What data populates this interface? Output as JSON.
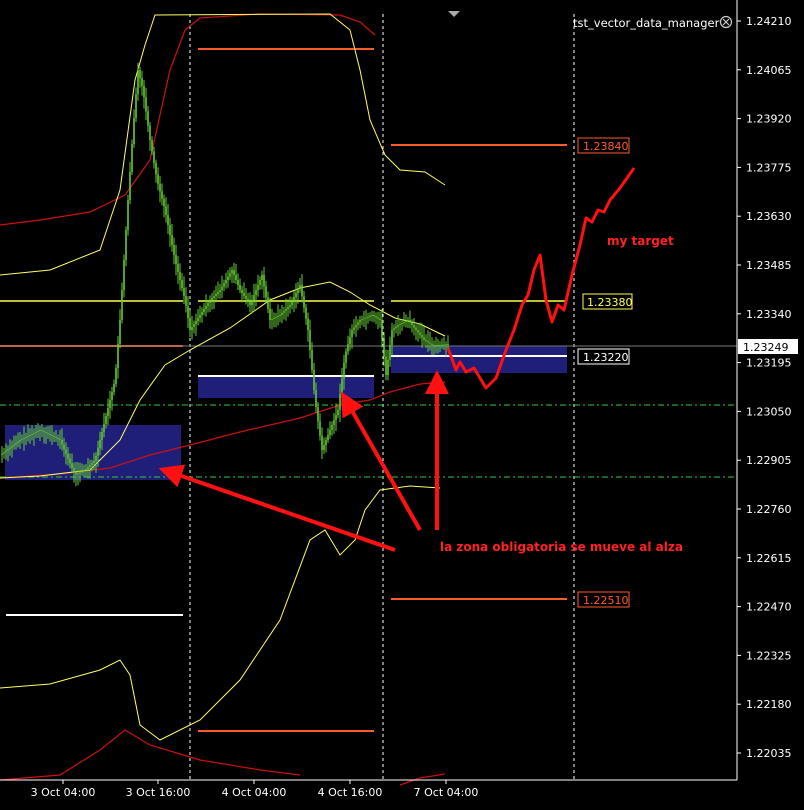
{
  "indicator_title": "tst_vector_data_manager",
  "indicator_close_icon": "close-circle-icon",
  "price_axis": {
    "ticks": [
      "1.24210",
      "1.24065",
      "1.23920",
      "1.23775",
      "1.23630",
      "1.23485",
      "1.23340",
      "1.23195",
      "1.23050",
      "1.22905",
      "1.22760",
      "1.22615",
      "1.22470",
      "1.22325",
      "1.22180",
      "1.22035"
    ],
    "current_price": "1.23249"
  },
  "time_axis": {
    "ticks": [
      "3 Oct 04:00",
      "3 Oct 16:00",
      "4 Oct 04:00",
      "4 Oct 16:00",
      "7 Oct 04:00"
    ]
  },
  "level_labels": [
    {
      "text": "1.23840",
      "color": "#ff5a2a"
    },
    {
      "text": "1.23380",
      "color": "#ffff55"
    },
    {
      "text": "1.23220",
      "color": "#ffffff"
    },
    {
      "text": "1.22510",
      "color": "#ff5a2a"
    }
  ],
  "annotations": {
    "target": "my target",
    "zone": "la zona obligatoria se mueve al alza"
  },
  "colors": {
    "background": "#000000",
    "candles": "#66cc33",
    "bollinger": "#ffff66",
    "moving_average": "#cc1111",
    "resistance": "#ff5a2a",
    "pivot": "#ffff44",
    "zone": "#1f1f7a",
    "arrows": "#ff1111",
    "grid": "#ffffff"
  }
}
